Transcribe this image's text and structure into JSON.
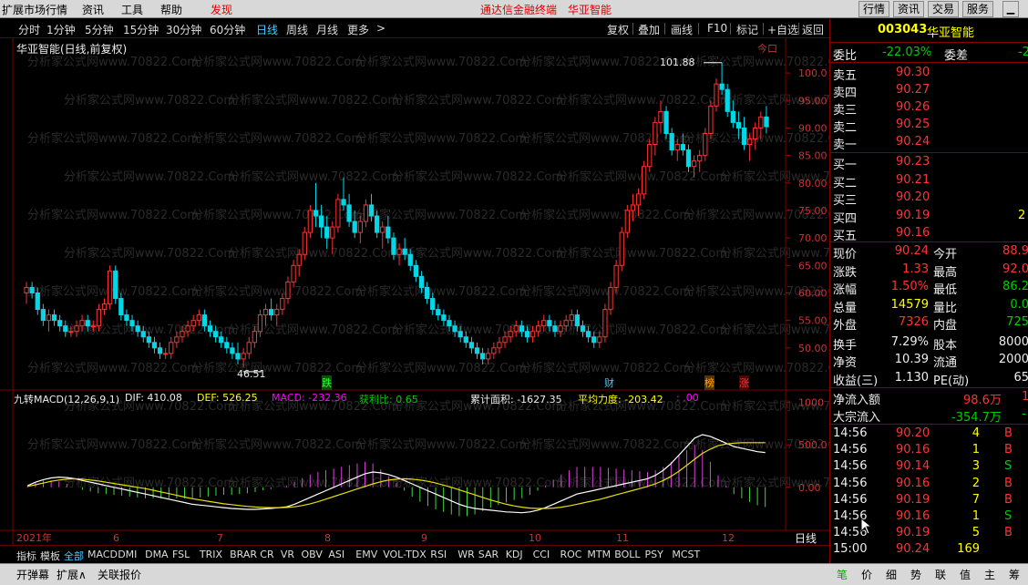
{
  "menu": {
    "items": [
      "扩展市场行情",
      "资讯",
      "工具",
      "帮助"
    ],
    "discover": "发现",
    "center_title": "通达信金融终端",
    "stock_title": "华亚智能",
    "right_buttons": [
      "行情",
      "资讯",
      "交易",
      "服务"
    ]
  },
  "periods": {
    "items": [
      "分时",
      "1分钟",
      "5分钟",
      "15分钟",
      "30分钟",
      "60分钟",
      "日线",
      "周线",
      "月线",
      "更多"
    ],
    "active": "日线",
    "more_arrow": ">"
  },
  "tools": [
    "复权",
    "叠加",
    "画线",
    "F10",
    "标记",
    "+自选",
    "返回"
  ],
  "chart_header": {
    "title": "华亚智能(日线,前复权)",
    "watermark": "分析家公式网www.70822.Com",
    "high_label": "101.88",
    "low_label": "46.51",
    "top_right_mark": "今口"
  },
  "markers": {
    "die": "跌",
    "cai": "财",
    "bang": "榜",
    "zhang": "涨"
  },
  "indicator_header": {
    "name": "九转MACD(12,26,9,1)",
    "dif": "DIF: 410.08",
    "def": "DEF: 526.25",
    "macd": "MACD: -232.36",
    "profit": "获利比: 0.65",
    "cumulative": "累计面积: -1627.35",
    "avg_force": "平均力度: -203.42",
    "last": ": .00"
  },
  "chart_data": {
    "type": "candlestick",
    "price_axis": {
      "ticks": [
        "100.0",
        "95.00",
        "90.00",
        "85.00",
        "80.00",
        "75.00",
        "70.00",
        "65.00",
        "60.00",
        "55.00",
        "50.00"
      ],
      "ylim": [
        45,
        103
      ]
    },
    "macd_axis": {
      "ticks": [
        "1000",
        "500.0",
        "0.00"
      ]
    },
    "time_axis": {
      "labels": [
        "2021年",
        "6",
        "7",
        "8",
        "9",
        "10",
        "11",
        "12"
      ]
    },
    "candles": [
      [
        60,
        62,
        58,
        61
      ],
      [
        61,
        62,
        59,
        60
      ],
      [
        60,
        61,
        56,
        57
      ],
      [
        57,
        58,
        54,
        55
      ],
      [
        55,
        57,
        53,
        56
      ],
      [
        56,
        57,
        54,
        55
      ],
      [
        55,
        56,
        53,
        54
      ],
      [
        54,
        55,
        52,
        53
      ],
      [
        53,
        54,
        52,
        53
      ],
      [
        53,
        55,
        52,
        54
      ],
      [
        54,
        56,
        53,
        55
      ],
      [
        55,
        56,
        53,
        54
      ],
      [
        54,
        55,
        53,
        54
      ],
      [
        54,
        58,
        53,
        57
      ],
      [
        57,
        59,
        56,
        58
      ],
      [
        58,
        65,
        57,
        64
      ],
      [
        64,
        65,
        58,
        59
      ],
      [
        59,
        60,
        55,
        56
      ],
      [
        56,
        57,
        54,
        55
      ],
      [
        55,
        56,
        53,
        54
      ],
      [
        54,
        55,
        52,
        53
      ],
      [
        53,
        54,
        51,
        52
      ],
      [
        52,
        53,
        50,
        51
      ],
      [
        51,
        52,
        49,
        50
      ],
      [
        50,
        51,
        48,
        49
      ],
      [
        49,
        50,
        48,
        49
      ],
      [
        49,
        52,
        48,
        51
      ],
      [
        51,
        53,
        50,
        52
      ],
      [
        52,
        54,
        51,
        53
      ],
      [
        53,
        55,
        52,
        54
      ],
      [
        54,
        56,
        53,
        55
      ],
      [
        55,
        57,
        54,
        56
      ],
      [
        56,
        57,
        53,
        54
      ],
      [
        54,
        55,
        52,
        53
      ],
      [
        53,
        54,
        51,
        52
      ],
      [
        52,
        53,
        50,
        51
      ],
      [
        51,
        52,
        49,
        50
      ],
      [
        50,
        51,
        48,
        49
      ],
      [
        49,
        51,
        47,
        48
      ],
      [
        48,
        50,
        46.51,
        49
      ],
      [
        49,
        52,
        48,
        51
      ],
      [
        51,
        54,
        50,
        53
      ],
      [
        53,
        57,
        52,
        56
      ],
      [
        56,
        58,
        54,
        57
      ],
      [
        57,
        59,
        55,
        56
      ],
      [
        56,
        58,
        54,
        57
      ],
      [
        57,
        60,
        56,
        59
      ],
      [
        59,
        63,
        58,
        62
      ],
      [
        62,
        66,
        61,
        65
      ],
      [
        65,
        68,
        63,
        67
      ],
      [
        67,
        72,
        66,
        71
      ],
      [
        71,
        76,
        70,
        75
      ],
      [
        75,
        80,
        72,
        74
      ],
      [
        74,
        76,
        70,
        72
      ],
      [
        72,
        74,
        68,
        70
      ],
      [
        70,
        73,
        67,
        72
      ],
      [
        72,
        78,
        71,
        77
      ],
      [
        77,
        81,
        75,
        76
      ],
      [
        76,
        78,
        72,
        73
      ],
      [
        73,
        75,
        70,
        71
      ],
      [
        71,
        74,
        69,
        73
      ],
      [
        73,
        77,
        72,
        76
      ],
      [
        76,
        78,
        73,
        74
      ],
      [
        74,
        75,
        70,
        71
      ],
      [
        71,
        73,
        68,
        72
      ],
      [
        72,
        74,
        69,
        70
      ],
      [
        70,
        71,
        66,
        67
      ],
      [
        67,
        69,
        65,
        68
      ],
      [
        68,
        70,
        66,
        67
      ],
      [
        67,
        68,
        64,
        65
      ],
      [
        65,
        66,
        62,
        63
      ],
      [
        63,
        64,
        60,
        61
      ],
      [
        61,
        62,
        58,
        59
      ],
      [
        59,
        60,
        56,
        57
      ],
      [
        57,
        58,
        55,
        56
      ],
      [
        56,
        57,
        54,
        55
      ],
      [
        55,
        56,
        53,
        54
      ],
      [
        54,
        55,
        52,
        53
      ],
      [
        53,
        54,
        51,
        52
      ],
      [
        52,
        53,
        50,
        51
      ],
      [
        51,
        52,
        49,
        50
      ],
      [
        50,
        51,
        48,
        49
      ],
      [
        49,
        50,
        47,
        48
      ],
      [
        48,
        50,
        47,
        49
      ],
      [
        49,
        51,
        48,
        50
      ],
      [
        50,
        52,
        49,
        51
      ],
      [
        51,
        53,
        50,
        52
      ],
      [
        52,
        54,
        51,
        53
      ],
      [
        53,
        55,
        52,
        54
      ],
      [
        54,
        55,
        52,
        53
      ],
      [
        53,
        54,
        51,
        52
      ],
      [
        52,
        54,
        51,
        53
      ],
      [
        53,
        55,
        52,
        54
      ],
      [
        54,
        56,
        53,
        55
      ],
      [
        55,
        56,
        53,
        54
      ],
      [
        54,
        55,
        52,
        53
      ],
      [
        53,
        55,
        52,
        54
      ],
      [
        54,
        56,
        53,
        55
      ],
      [
        55,
        57,
        54,
        56
      ],
      [
        56,
        57,
        53,
        54
      ],
      [
        54,
        55,
        52,
        53
      ],
      [
        53,
        54,
        51,
        52
      ],
      [
        52,
        53,
        50,
        51
      ],
      [
        51,
        53,
        50,
        52
      ],
      [
        52,
        58,
        51,
        57
      ],
      [
        57,
        62,
        56,
        61
      ],
      [
        61,
        66,
        60,
        65
      ],
      [
        65,
        72,
        64,
        71
      ],
      [
        71,
        76,
        70,
        75
      ],
      [
        75,
        78,
        73,
        76
      ],
      [
        76,
        79,
        74,
        78
      ],
      [
        78,
        84,
        77,
        83
      ],
      [
        83,
        88,
        82,
        87
      ],
      [
        87,
        92,
        85,
        91
      ],
      [
        91,
        95,
        89,
        93
      ],
      [
        93,
        94,
        88,
        89
      ],
      [
        89,
        90,
        85,
        86
      ],
      [
        86,
        88,
        84,
        87
      ],
      [
        87,
        89,
        85,
        86
      ],
      [
        86,
        87,
        82,
        83
      ],
      [
        83,
        85,
        81,
        84
      ],
      [
        84,
        86,
        82,
        85
      ],
      [
        85,
        90,
        84,
        89
      ],
      [
        89,
        95,
        88,
        94
      ],
      [
        94,
        99,
        93,
        98
      ],
      [
        98,
        101.88,
        96,
        97
      ],
      [
        97,
        98,
        92,
        93
      ],
      [
        93,
        95,
        90,
        91
      ],
      [
        91,
        93,
        88,
        90
      ],
      [
        90,
        92,
        86,
        87
      ],
      [
        87,
        89,
        84,
        88
      ],
      [
        88,
        91,
        86,
        90
      ],
      [
        90,
        93,
        88,
        92
      ],
      [
        92,
        94,
        89,
        90.24
      ]
    ],
    "macd_dif": [
      20,
      60,
      90,
      110,
      120,
      115,
      100,
      80,
      60,
      40,
      20,
      0,
      -20,
      -40,
      -60,
      -80,
      -100,
      -120,
      -140,
      -160,
      -180,
      -200,
      -210,
      -220,
      -230,
      -240,
      -250,
      -255,
      -260,
      -260,
      -255,
      -250,
      -240,
      -230,
      -200,
      -160,
      -120,
      -80,
      -40,
      0,
      40,
      80,
      120,
      160,
      180,
      170,
      150,
      120,
      80,
      40,
      0,
      -40,
      -80,
      -120,
      -160,
      -200,
      -230,
      -250,
      -260,
      -270,
      -280,
      -290,
      -295,
      -300,
      -290,
      -270,
      -240,
      -200,
      -160,
      -120,
      -80,
      -60,
      -40,
      -20,
      0,
      20,
      40,
      60,
      80,
      100,
      140,
      200,
      280,
      380,
      480,
      580,
      620,
      600,
      560,
      520,
      480,
      460,
      440,
      420,
      410.08
    ],
    "macd_dea": [
      10,
      30,
      50,
      70,
      85,
      95,
      100,
      95,
      85,
      75,
      60,
      45,
      30,
      15,
      0,
      -15,
      -35,
      -55,
      -75,
      -95,
      -115,
      -135,
      -150,
      -165,
      -180,
      -195,
      -205,
      -215,
      -225,
      -232,
      -237,
      -240,
      -240,
      -238,
      -230,
      -215,
      -195,
      -170,
      -140,
      -110,
      -80,
      -50,
      -20,
      10,
      40,
      65,
      85,
      95,
      100,
      95,
      85,
      70,
      50,
      25,
      0,
      -30,
      -60,
      -90,
      -120,
      -150,
      -175,
      -200,
      -220,
      -235,
      -245,
      -250,
      -250,
      -245,
      -235,
      -220,
      -200,
      -180,
      -160,
      -140,
      -115,
      -90,
      -65,
      -40,
      -15,
      10,
      40,
      80,
      130,
      190,
      260,
      330,
      400,
      450,
      490,
      510,
      520,
      525,
      526,
      526.25,
      526.25
    ]
  },
  "quote": {
    "code": "003043",
    "name": "华亚智能",
    "webi_label": "委比",
    "webi_value": "-22.03%",
    "weicha_label": "委差",
    "weicha_value": "-2",
    "sell": [
      {
        "label": "卖五",
        "price": "90.30",
        "vol": ""
      },
      {
        "label": "卖四",
        "price": "90.27",
        "vol": ""
      },
      {
        "label": "卖三",
        "price": "90.26",
        "vol": ""
      },
      {
        "label": "卖二",
        "price": "90.25",
        "vol": ""
      },
      {
        "label": "卖一",
        "price": "90.24",
        "vol": ""
      }
    ],
    "buy": [
      {
        "label": "买一",
        "price": "90.23",
        "vol": ""
      },
      {
        "label": "买二",
        "price": "90.21",
        "vol": ""
      },
      {
        "label": "买三",
        "price": "90.20",
        "vol": ""
      },
      {
        "label": "买四",
        "price": "90.19",
        "vol": "2"
      },
      {
        "label": "买五",
        "price": "90.16",
        "vol": ""
      }
    ],
    "stats": [
      {
        "l1": "现价",
        "v1": "90.24",
        "l2": "今开",
        "v2": "88.9"
      },
      {
        "l1": "涨跌",
        "v1": "1.33",
        "l2": "最高",
        "v2": "92.0"
      },
      {
        "l1": "涨幅",
        "v1": "1.50%",
        "l2": "最低",
        "v2": "86.2"
      },
      {
        "l1": "总量",
        "v1": "14579",
        "l2": "量比",
        "v2": "0.0"
      },
      {
        "l1": "外盘",
        "v1": "7326",
        "l2": "内盘",
        "v2": "725"
      },
      {
        "l1": "换手",
        "v1": "7.29%",
        "l2": "股本",
        "v2": "8000"
      },
      {
        "l1": "净资",
        "v1": "10.39",
        "l2": "流通",
        "v2": "2000"
      },
      {
        "l1": "收益(三)",
        "v1": "1.130",
        "l2": "PE(动)",
        "v2": "65"
      }
    ],
    "net_inflow_label": "净流入额",
    "net_inflow_value": "98.6万",
    "net_inflow_extra": "1",
    "big_inflow_label": "大宗流入",
    "big_inflow_value": "-354.7万",
    "big_inflow_extra": "-",
    "ticks": [
      {
        "time": "14:56",
        "price": "90.20",
        "vol": "4",
        "bs": "B"
      },
      {
        "time": "14:56",
        "price": "90.16",
        "vol": "1",
        "bs": "B"
      },
      {
        "time": "14:56",
        "price": "90.14",
        "vol": "3",
        "bs": "S"
      },
      {
        "time": "14:56",
        "price": "90.16",
        "vol": "2",
        "bs": "B"
      },
      {
        "time": "14:56",
        "price": "90.19",
        "vol": "7",
        "bs": "B"
      },
      {
        "time": "14:56",
        "price": "90.16",
        "vol": "1",
        "bs": "S"
      },
      {
        "time": "14:56",
        "price": "90.19",
        "vol": "5",
        "bs": "B"
      },
      {
        "time": "15:00",
        "price": "90.24",
        "vol": "169",
        "bs": ""
      }
    ]
  },
  "bottom_tabs": {
    "items": [
      "指标",
      "模板",
      "全部",
      "MACD",
      "DMI",
      "DMA",
      "FSL",
      "TRIX",
      "BRAR",
      "CR",
      "VR",
      "OBV",
      "ASI",
      "EMV",
      "VOL-TDX",
      "RSI",
      "WR",
      "SAR",
      "KDJ",
      "CCI",
      "ROC",
      "MTM",
      "BOLL",
      "PSY",
      "MCST"
    ],
    "active": "全部",
    "day_label": "日线"
  },
  "statusbar": {
    "items": [
      "开弹幕",
      "扩展∧",
      "关联报价"
    ],
    "right_tabs": [
      "笔",
      "价",
      "细",
      "势",
      "联",
      "值",
      "主",
      "筹"
    ],
    "active_right": "笔"
  }
}
